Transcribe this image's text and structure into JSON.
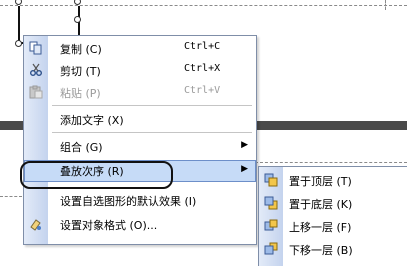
{
  "menu": {
    "items": [
      {
        "label": "复制 (C)",
        "shortcut": "Ctrl+C"
      },
      {
        "label": "剪切 (T)",
        "shortcut": "Ctrl+X"
      },
      {
        "label": "粘贴 (P)",
        "shortcut": "Ctrl+V"
      },
      {
        "label": "添加文字 (X)"
      },
      {
        "label": "组合 (G)"
      },
      {
        "label": "叠放次序 (R)"
      },
      {
        "label": "设置自选图形的默认效果 (I)"
      },
      {
        "label": "设置对象格式 (O)..."
      }
    ]
  },
  "submenu": {
    "items": [
      {
        "label": "置于顶层 (T)"
      },
      {
        "label": "置于底层 (K)"
      },
      {
        "label": "上移一层 (F)"
      },
      {
        "label": "下移一层 (B)"
      }
    ]
  },
  "icons": {
    "copy": "copy-icon",
    "cut": "scissors-icon",
    "paste": "paste-icon",
    "format": "format-icon",
    "order": [
      "bring-to-front-icon",
      "send-to-back-icon",
      "bring-forward-icon",
      "send-backward-icon"
    ]
  },
  "colors": {
    "menu_gutter": "#c4d3ee",
    "menu_border": "#7f8ea8",
    "active_item": "#c6dbf7",
    "canvas_band": "#4a4a4a"
  }
}
